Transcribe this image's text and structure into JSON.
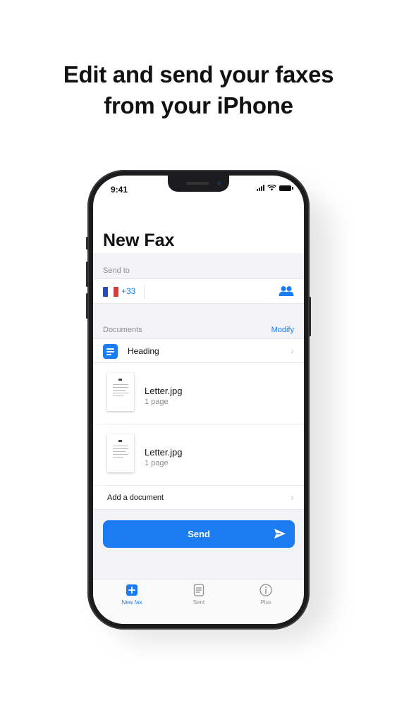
{
  "promo": {
    "title_line1": "Edit and send your faxes",
    "title_line2": "from your iPhone"
  },
  "status_bar": {
    "time": "9:41"
  },
  "nav": {
    "title": "New Fax"
  },
  "send_to": {
    "section_label": "Send to",
    "country_flag": "france-flag",
    "dial_code": "+33",
    "contacts_icon": "contacts-icon"
  },
  "documents": {
    "section_label": "Documents",
    "modify_label": "Modify",
    "heading_row": {
      "icon": "doc-lines-icon",
      "label": "Heading"
    },
    "files": [
      {
        "name": "Letter.jpg",
        "pages": "1 page"
      },
      {
        "name": "Letter.jpg",
        "pages": "1 page"
      }
    ],
    "add_label": "Add a document"
  },
  "send_button": {
    "label": "Send",
    "icon": "paper-plane-icon"
  },
  "tabbar": {
    "tabs": [
      {
        "label": "New fax",
        "icon": "plus-square-icon",
        "active": true
      },
      {
        "label": "Sent",
        "icon": "doc-icon",
        "active": false
      },
      {
        "label": "Plus",
        "icon": "info-circle-icon",
        "active": false
      }
    ]
  },
  "colors": {
    "accent": "#1a7cf0",
    "background": "#f2f2f7",
    "secondary_text": "#8e8e93"
  }
}
